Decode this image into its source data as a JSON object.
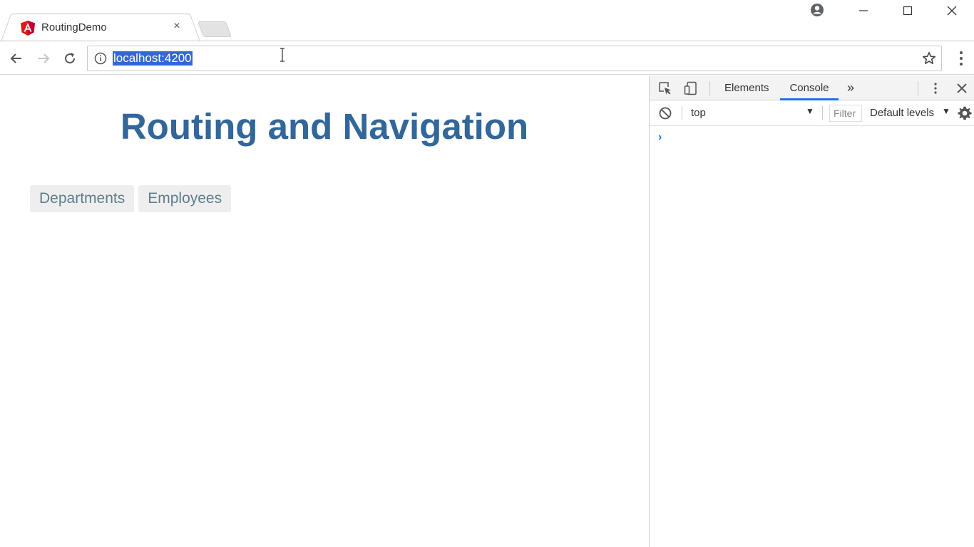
{
  "browser": {
    "tab": {
      "title": "RoutingDemo",
      "close_glyph": "×",
      "favicon": "angular-icon"
    },
    "new_tab": "new-tab-icon",
    "address": {
      "url": "localhost:4200"
    },
    "colors": {
      "selection": "#3367d6",
      "accent": "#1a73e8"
    }
  },
  "page": {
    "title": "Routing and Navigation",
    "links": [
      {
        "label": "Departments"
      },
      {
        "label": "Employees"
      }
    ],
    "colors": {
      "title": "#336699",
      "link_text": "#607d8b",
      "link_bg": "#eeeeee"
    }
  },
  "devtools": {
    "tabs": [
      {
        "label": "Elements",
        "active": false
      },
      {
        "label": "Console",
        "active": true
      }
    ],
    "more_glyph": "»",
    "context": "top",
    "filter_placeholder": "Filter",
    "levels": "Default levels",
    "prompt": "›"
  }
}
